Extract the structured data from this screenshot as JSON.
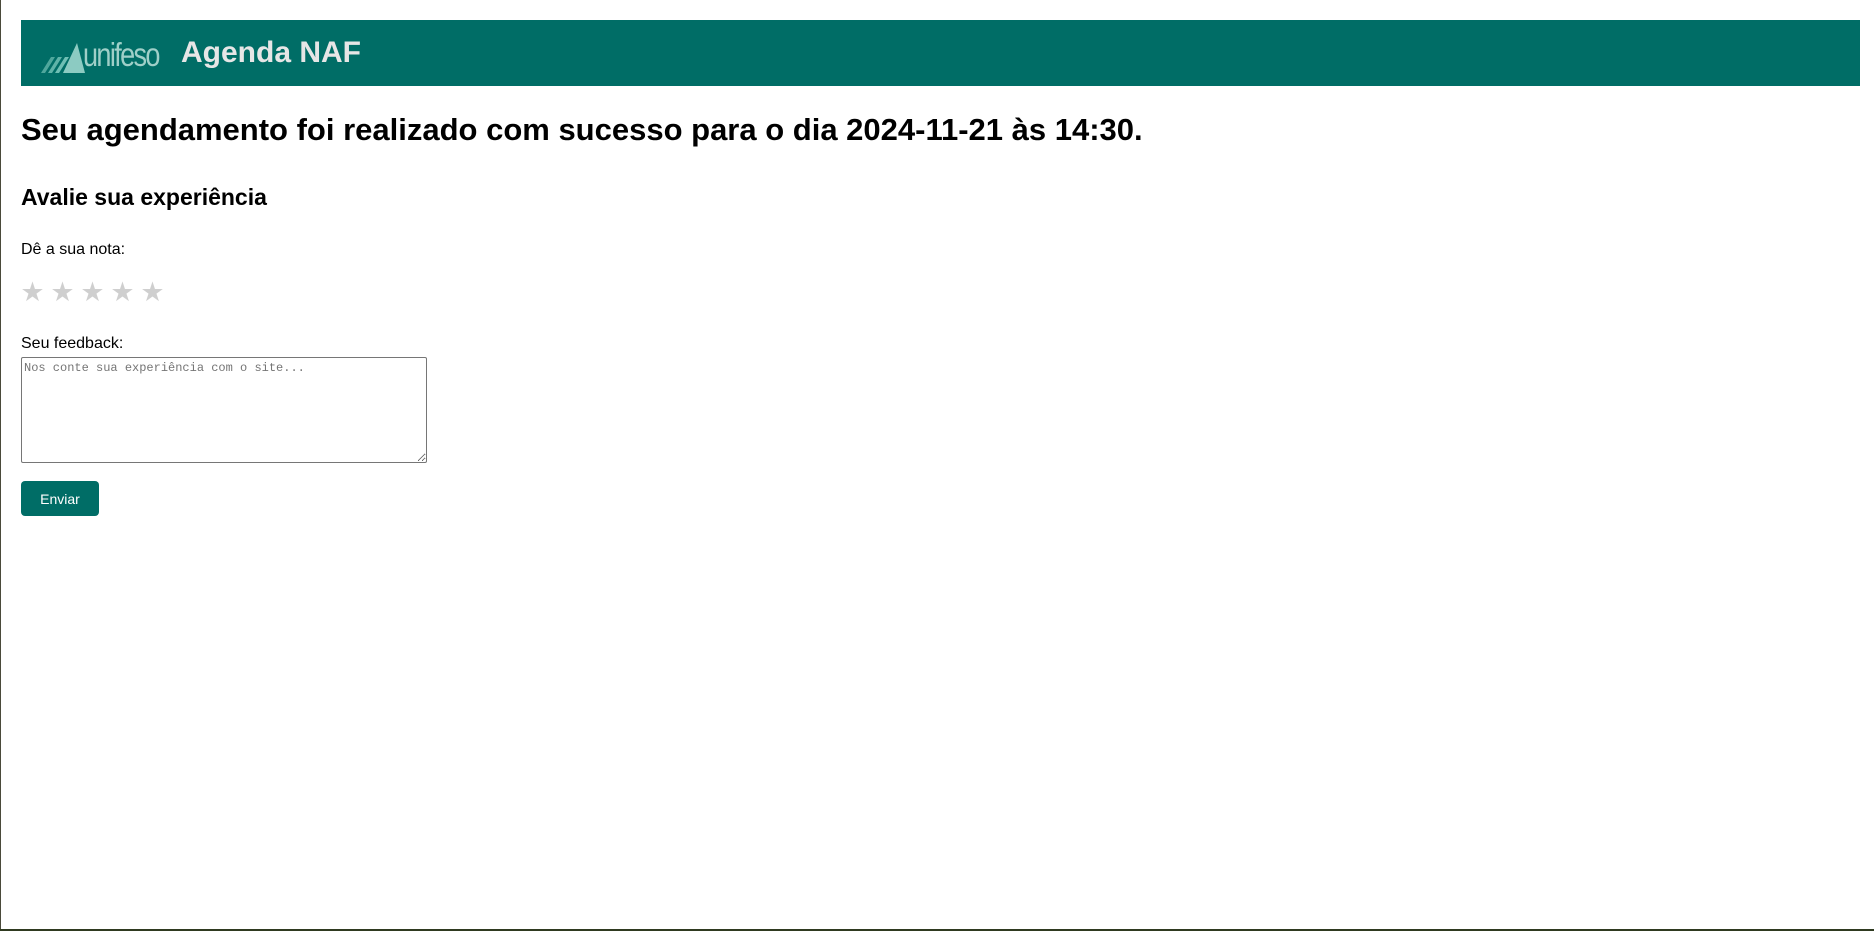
{
  "header": {
    "logo_text": "unifeso",
    "title": "Agenda NAF"
  },
  "confirmation": {
    "message": "Seu agendamento foi realizado com sucesso para o dia 2024-11-21 às 14:30."
  },
  "rating": {
    "heading": "Avalie sua experiência",
    "label": "Dê a sua nota:",
    "stars": [
      "★",
      "★",
      "★",
      "★",
      "★"
    ],
    "max": 5,
    "value": 0
  },
  "feedback": {
    "label": "Seu feedback:",
    "value": "",
    "placeholder": "Nos conte sua experiência com o site..."
  },
  "submit": {
    "label": "Enviar"
  },
  "colors": {
    "brand": "#006d66",
    "header_title": "#e6e6e6",
    "star_inactive": "#cfcfcf"
  }
}
